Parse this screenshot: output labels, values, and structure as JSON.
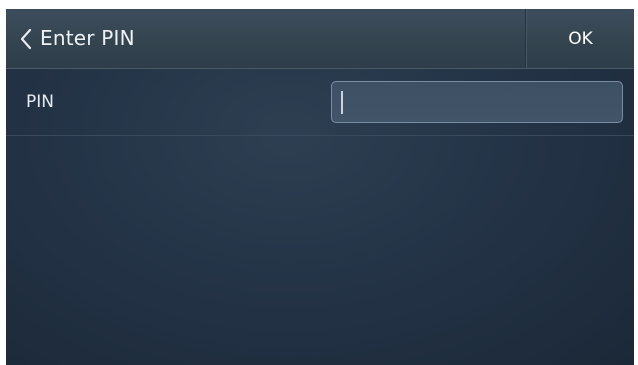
{
  "header": {
    "title": "Enter PIN",
    "back_icon": "chevron-left-icon",
    "ok_label": "OK"
  },
  "form": {
    "pin_label": "PIN",
    "pin_value": "",
    "pin_placeholder": ""
  },
  "colors": {
    "background": "#243447",
    "header": "#36454f",
    "text": "#eef2f6",
    "input_border": "#7a8da0"
  }
}
